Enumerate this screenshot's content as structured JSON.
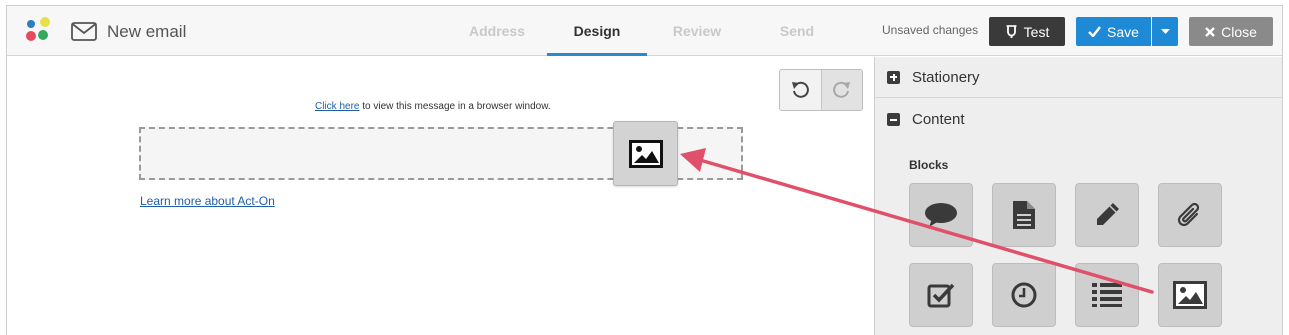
{
  "header": {
    "title": "New email",
    "steps": [
      "Address",
      "Design",
      "Review",
      "Send"
    ],
    "unsaved": "Unsaved changes",
    "test_label": "Test",
    "save_label": "Save",
    "close_label": "Close"
  },
  "canvas": {
    "view_link": "Click here",
    "view_text": " to view this message in a browser window.",
    "learn_link": "Learn more about Act-On"
  },
  "panel": {
    "stationery": "Stationery",
    "content": "Content",
    "blocks_title": "Blocks"
  },
  "colors": {
    "accent": "#1e8ad6",
    "arrow": "#e0506a"
  }
}
